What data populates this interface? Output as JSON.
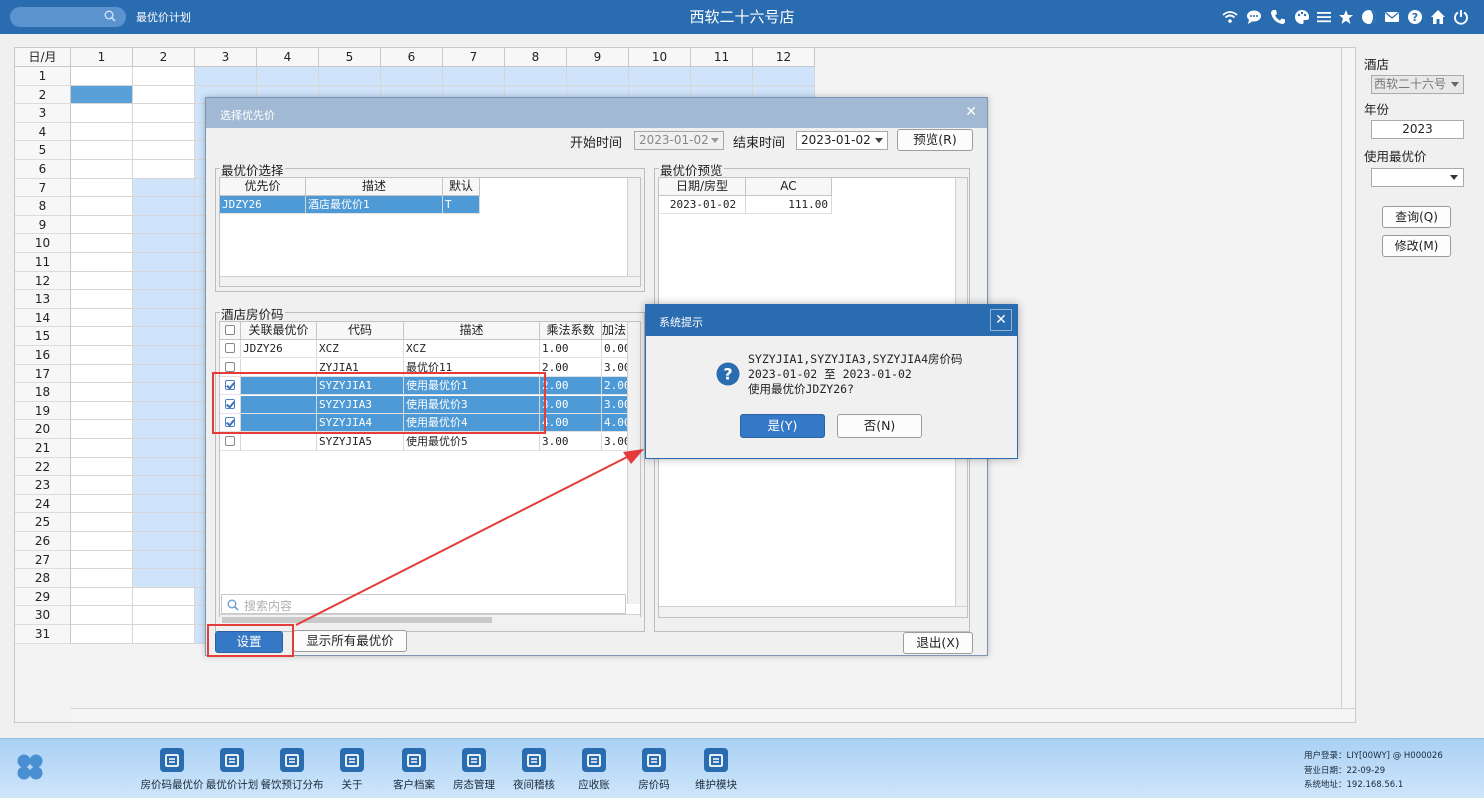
{
  "titlebar": {
    "module_title": "最优价计划",
    "hotel_title": "西软二十六号店",
    "icons": [
      "wifi-icon",
      "chat-icon",
      "phone-icon",
      "palette-icon",
      "menu-icon",
      "star-icon",
      "moon-icon",
      "mail-icon",
      "help-icon",
      "home-icon",
      "power-icon"
    ]
  },
  "grid": {
    "corner": "日/月",
    "months": [
      "1",
      "2",
      "3",
      "4",
      "5",
      "6",
      "7",
      "8",
      "9",
      "10",
      "11",
      "12"
    ],
    "days": [
      "1",
      "2",
      "3",
      "4",
      "5",
      "6",
      "7",
      "8",
      "9",
      "10",
      "11",
      "12",
      "13",
      "14",
      "15",
      "16",
      "17",
      "18",
      "19",
      "20",
      "21",
      "22",
      "23",
      "24",
      "25",
      "26",
      "27",
      "28",
      "29",
      "30",
      "31"
    ]
  },
  "right_panel": {
    "hotel_label": "酒店",
    "hotel_value": "西软二十六号",
    "year_label": "年份",
    "year_value": "2023",
    "use_best_label": "使用最优价",
    "use_best_value": "",
    "query_button": "查询(Q)",
    "modify_button": "修改(M)"
  },
  "dialog": {
    "title": "选择优先价",
    "start_label": "开始时间",
    "start_value": "2023-01-02",
    "end_label": "结束时间",
    "end_value": "2023-01-02",
    "preview_button": "预览(R)",
    "best_select_group": "最优价选择",
    "best_table": {
      "headers": [
        "优先价",
        "描述",
        "默认"
      ],
      "rows": [
        [
          "JDZY26",
          "酒店最优价1",
          "T"
        ]
      ]
    },
    "preview_group": "最优价预览",
    "preview_table": {
      "headers": [
        "日期/房型",
        "AC"
      ],
      "rows": [
        [
          "2023-01-02",
          "111.00"
        ]
      ]
    },
    "room_code_group": "酒店房价码",
    "room_table": {
      "headers": [
        "",
        "关联最优价",
        "代码",
        "描述",
        "乘法系数",
        "加法"
      ],
      "rows": [
        {
          "checked": false,
          "linked": "JDZY26",
          "code": "XCZ",
          "desc": "XCZ",
          "mult": "1.00",
          "add": "0.00"
        },
        {
          "checked": false,
          "linked": "",
          "code": "ZYJIA1",
          "desc": "最优价11",
          "mult": "2.00",
          "add": "3.00"
        },
        {
          "checked": true,
          "linked": "",
          "code": "SYZYJIA1",
          "desc": "使用最优价1",
          "mult": "2.00",
          "add": "2.00"
        },
        {
          "checked": true,
          "linked": "",
          "code": "SYZYJIA3",
          "desc": "使用最优价3",
          "mult": "3.00",
          "add": "3.00"
        },
        {
          "checked": true,
          "linked": "",
          "code": "SYZYJIA4",
          "desc": "使用最优价4",
          "mult": "4.00",
          "add": "4.00"
        },
        {
          "checked": false,
          "linked": "",
          "code": "SYZYJIA5",
          "desc": "使用最优价5",
          "mult": "3.00",
          "add": "3.00"
        }
      ]
    },
    "search_placeholder": "搜索内容",
    "set_button": "设置",
    "show_all_button": "显示所有最优价",
    "exit_button": "退出(X)"
  },
  "message_box": {
    "title": "系统提示",
    "line1": "SYZYJIA1,SYZYJIA3,SYZYJIA4房价码",
    "line2": "2023-01-02 至 2023-01-02",
    "line3": "使用最优价JDZY26?",
    "yes_button": "是(Y)",
    "no_button": "否(N)"
  },
  "dock": {
    "items": [
      {
        "label": "房价码最优价",
        "icon": "home-price-icon"
      },
      {
        "label": "最优价计划",
        "icon": "calendar-icon"
      },
      {
        "label": "餐饮预订分布",
        "icon": "chart-icon"
      },
      {
        "label": "关于",
        "icon": "info-icon"
      },
      {
        "label": "客户档案",
        "icon": "contact-icon"
      },
      {
        "label": "房态管理",
        "icon": "house-icon"
      },
      {
        "label": "夜间稽核",
        "icon": "moon-icon"
      },
      {
        "label": "应收账",
        "icon": "download-icon"
      },
      {
        "label": "房价码",
        "icon": "home-icon"
      },
      {
        "label": "维护模块",
        "icon": "wrench-icon"
      }
    ],
    "user_login": "用户登录：",
    "user_value": "LIY[00WY] @ H000026",
    "biz_date": "营业日期：",
    "biz_value": "22-09-29",
    "sys_addr": "系统地址：",
    "sys_value": "192.168.56.1"
  },
  "colors": {
    "titlebar": "#2a6cb0",
    "selected_row": "#4d9ad6",
    "calendar_blue": "#cfe3fa",
    "annotation_red": "#e43b3b"
  }
}
